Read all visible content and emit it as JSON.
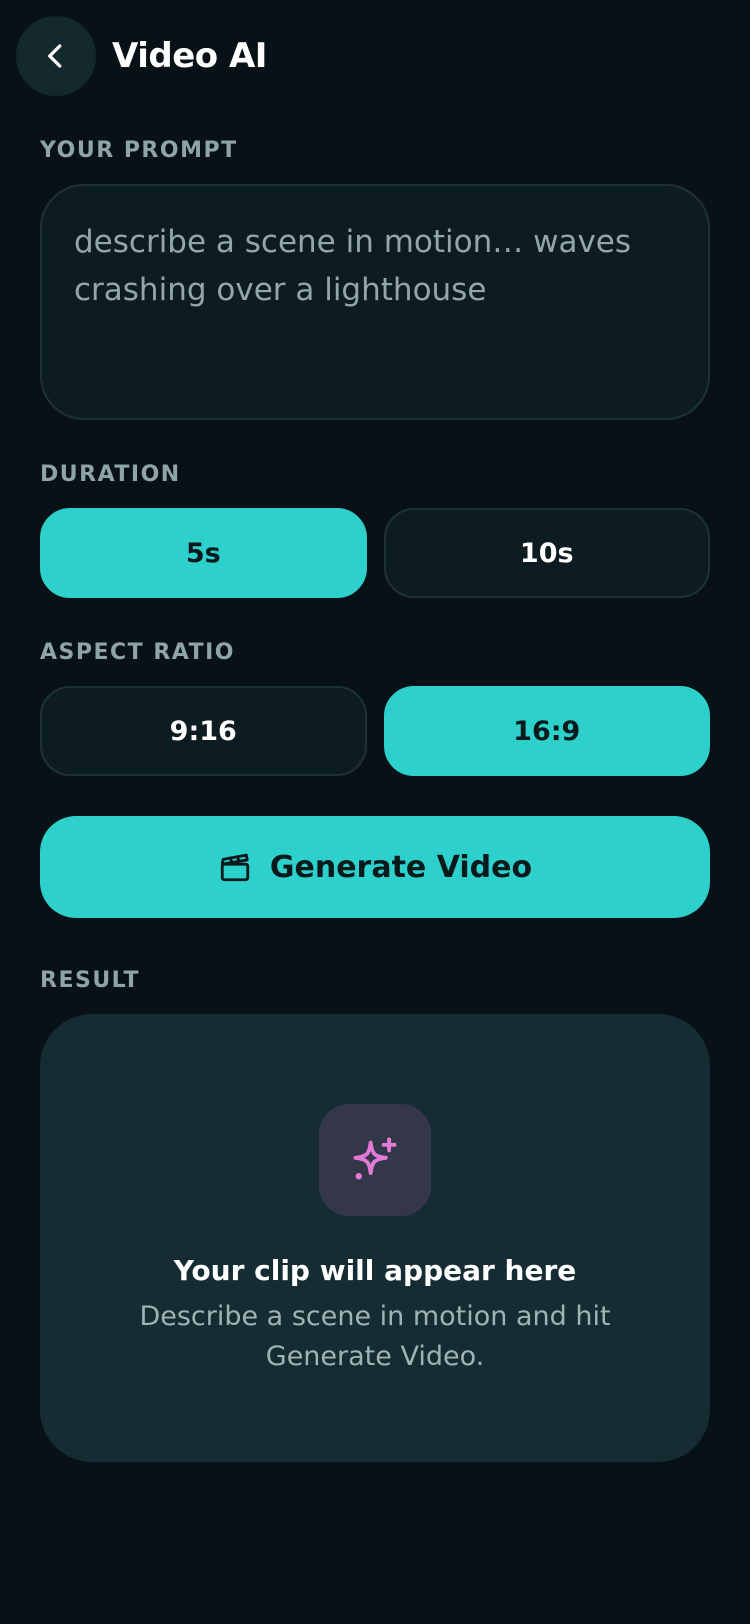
{
  "header": {
    "back_icon": "chevron-left-icon",
    "title": "Video AI"
  },
  "prompt": {
    "label": "YOUR PROMPT",
    "value": "",
    "placeholder": "describe a scene in motion… waves crashing over a lighthouse"
  },
  "duration": {
    "label": "DURATION",
    "options": [
      {
        "label": "5s",
        "selected": true
      },
      {
        "label": "10s",
        "selected": false
      }
    ]
  },
  "aspect_ratio": {
    "label": "ASPECT RATIO",
    "options": [
      {
        "label": "9:16",
        "selected": false
      },
      {
        "label": "16:9",
        "selected": true
      }
    ]
  },
  "generate": {
    "icon": "clapperboard-icon",
    "label": "Generate Video"
  },
  "result": {
    "label": "RESULT",
    "icon": "sparkle-icon",
    "title": "Your clip will appear here",
    "description": "Describe a scene in motion and hit Generate Video."
  },
  "colors": {
    "background": "#081216",
    "accent": "#2dd0ca",
    "card": "#142c32",
    "sparkle": "#e27bd6"
  }
}
